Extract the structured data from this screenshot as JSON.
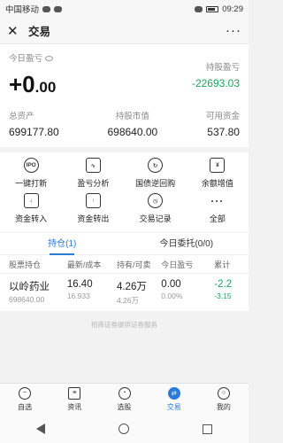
{
  "status_bar": {
    "carrier": "中国移动",
    "time": "09:29"
  },
  "nav": {
    "title": "交易"
  },
  "summary": {
    "today_pnl_label": "今日盈亏",
    "today_pnl_int": "+0",
    "today_pnl_dec": ".00",
    "hold_pnl_label": "持股盈亏",
    "hold_pnl_value": "-22693.03",
    "total_assets_label": "总资产",
    "total_assets_value": "699177.80",
    "market_value_label": "持股市值",
    "market_value_value": "698640.00",
    "available_label": "可用资金",
    "available_value": "537.80"
  },
  "functions": [
    {
      "label": "一键打新",
      "icon": "ipo-icon",
      "glyph": "IPO"
    },
    {
      "label": "盈亏分析",
      "icon": "chart-icon",
      "glyph": "∿"
    },
    {
      "label": "国债逆回购",
      "icon": "repo-icon",
      "glyph": "↻"
    },
    {
      "label": "余额增值",
      "icon": "yen-icon",
      "glyph": "¥"
    },
    {
      "label": "资金转入",
      "icon": "transfer-in-icon",
      "glyph": "↓"
    },
    {
      "label": "资金转出",
      "icon": "transfer-out-icon",
      "glyph": "↑"
    },
    {
      "label": "交易记录",
      "icon": "clock-icon",
      "glyph": "◷"
    },
    {
      "label": "全部",
      "icon": "more-icon",
      "glyph": "···"
    }
  ],
  "tabs": {
    "holdings": "持仓(1)",
    "orders": "今日委托(0/0)"
  },
  "table": {
    "headers": [
      "股票持仓",
      "最新/成本",
      "持有/可卖",
      "今日盈亏",
      "累计"
    ],
    "rows": [
      {
        "name": "以岭药业",
        "sub": "698640.00",
        "price": "16.40",
        "cost": "16.933",
        "hold": "4.26万",
        "sell": "4.26万",
        "today": "0.00",
        "today_pct": "0.00%",
        "total": "-2.2",
        "total_sub": "-3.15"
      }
    ]
  },
  "watermark": "招商证券提供证券服务",
  "tabbar": [
    {
      "label": "自选",
      "icon": "watchlist-icon",
      "glyph": "~"
    },
    {
      "label": "资讯",
      "icon": "news-icon",
      "glyph": "≡"
    },
    {
      "label": "选股",
      "icon": "stock-pick-icon",
      "glyph": "◔"
    },
    {
      "label": "交易",
      "icon": "trade-icon",
      "glyph": "⇄"
    },
    {
      "label": "我的",
      "icon": "profile-icon",
      "glyph": "○"
    }
  ],
  "colors": {
    "accent": "#2b7bd9",
    "down": "#1aa260"
  }
}
